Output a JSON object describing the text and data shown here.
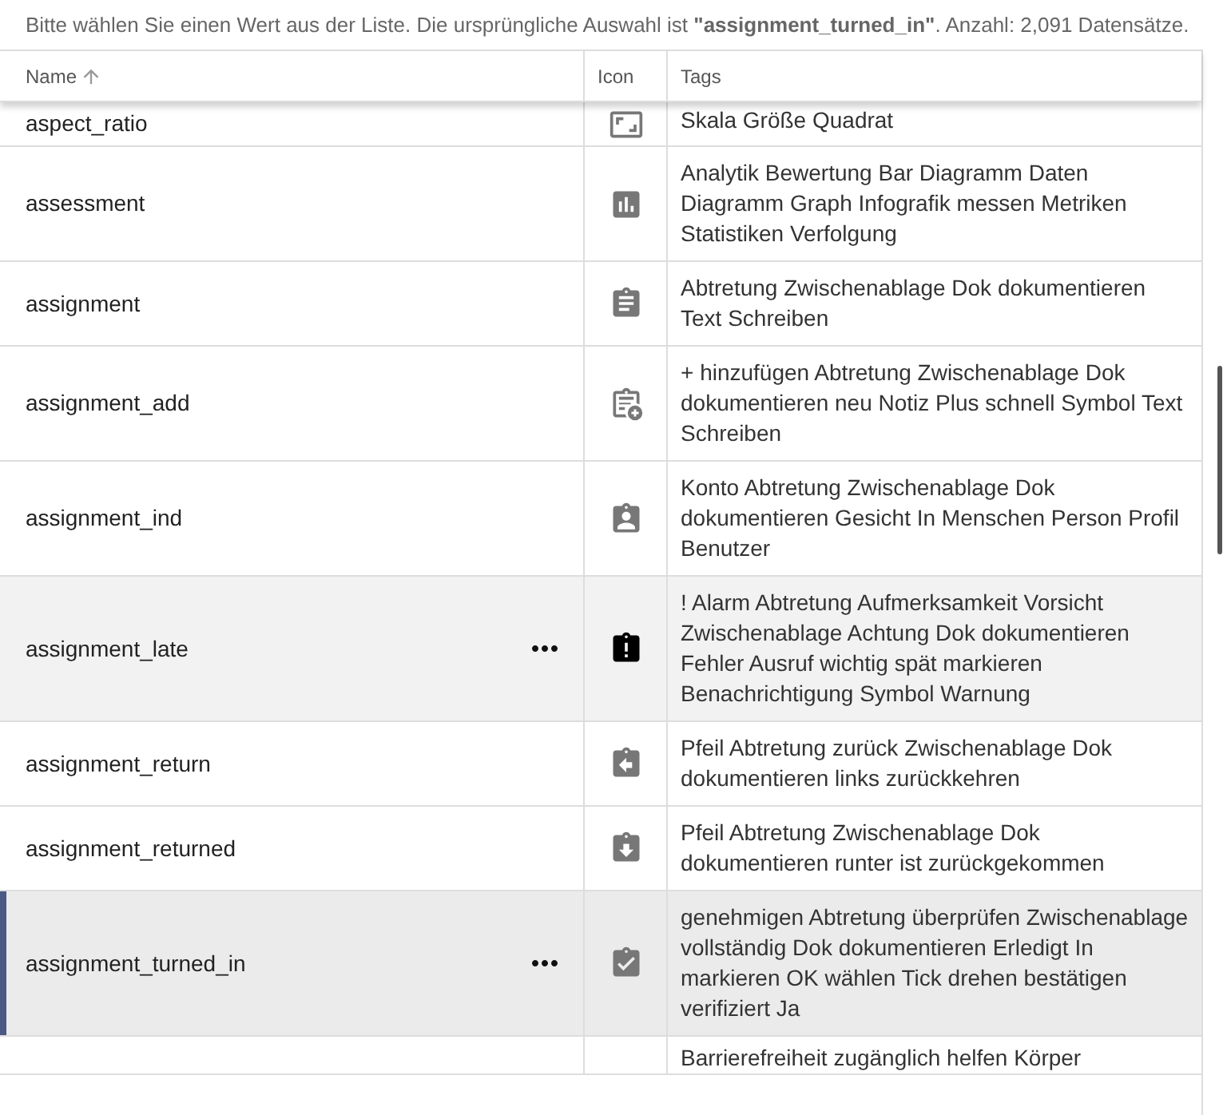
{
  "prompt": "Bitte wählen Sie einen Wert aus der Liste. Die ursprüngliche Auswahl ist **\"assignment_turned_in\"**. Anzahl: 2,091 Datensätze.",
  "table": {
    "columns": [
      {
        "label": "Name",
        "sorted": true
      },
      {
        "label": "Icon",
        "sorted": false
      },
      {
        "label": "Tags",
        "sorted": false
      }
    ],
    "rows": [
      {
        "name": "aspect_ratio",
        "kind": "aspect",
        "tags": "Skala Größe Quadrat",
        "selected": false,
        "hovered": false
      },
      {
        "name": "assessment",
        "kind": "chart",
        "tags": "Analytik Bewertung Bar Diagramm Daten Diagramm Graph Infografik messen Metriken Statistiken Verfolgung",
        "selected": false,
        "hovered": false
      },
      {
        "name": "assignment",
        "kind": "clipboard",
        "tags": "Abtretung Zwischenablage Dok dokumentieren Text Schreiben",
        "selected": false,
        "hovered": false
      },
      {
        "name": "assignment_add",
        "kind": "clipboard-plus",
        "tags": "+ hinzufügen Abtretung Zwischenablage Dok dokumentieren neu Notiz Plus schnell Symbol Text Schreiben",
        "selected": false,
        "hovered": false
      },
      {
        "name": "assignment_ind",
        "kind": "clipboard-person",
        "tags": "Konto Abtretung Zwischenablage Dok dokumentieren Gesicht In Menschen Person Profil Benutzer",
        "selected": false,
        "hovered": false
      },
      {
        "name": "assignment_late",
        "kind": "clipboard-alert",
        "tags": "! Alarm Abtretung Aufmerksamkeit Vorsicht Zwischenablage Achtung Dok dokumentieren Fehler Ausruf wichtig spät markieren Benachrichtigung Symbol Warnung",
        "selected": false,
        "hovered": true
      },
      {
        "name": "assignment_return",
        "kind": "clipboard-left",
        "tags": "Pfeil Abtretung zurück Zwischenablage Dok dokumentieren links zurückkehren",
        "selected": false,
        "hovered": false
      },
      {
        "name": "assignment_returned",
        "kind": "clipboard-down",
        "tags": "Pfeil Abtretung Zwischenablage Dok dokumentieren runter ist zurückgekommen",
        "selected": false,
        "hovered": false
      },
      {
        "name": "assignment_turned_in",
        "kind": "clipboard-check",
        "tags": "genehmigen Abtretung überprüfen Zwischenablage vollständig Dok dokumentieren Erledigt In markieren OK wählen Tick drehen bestätigen verifiziert Ja",
        "selected": true,
        "hovered": false
      },
      {
        "name": "",
        "kind": "none",
        "tags": "Barrierefreiheit zugänglich helfen Körper",
        "selected": false,
        "hovered": false
      }
    ]
  }
}
